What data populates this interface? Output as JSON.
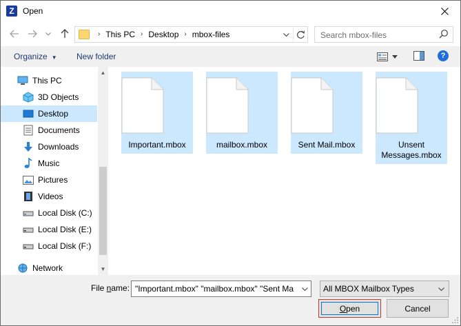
{
  "window": {
    "title": "Open",
    "app_icon_letter": "Z"
  },
  "address": {
    "crumbs": [
      "This PC",
      "Desktop",
      "mbox-files"
    ]
  },
  "search": {
    "placeholder": "Search mbox-files"
  },
  "toolbar": {
    "organize_label": "Organize",
    "new_folder_label": "New folder",
    "help_label": "?"
  },
  "nav": {
    "items": [
      {
        "label": "This PC",
        "icon": "this-pc-icon"
      },
      {
        "label": "3D Objects",
        "icon": "3d-objects-icon"
      },
      {
        "label": "Desktop",
        "icon": "desktop-icon",
        "selected": true
      },
      {
        "label": "Documents",
        "icon": "documents-icon"
      },
      {
        "label": "Downloads",
        "icon": "downloads-icon"
      },
      {
        "label": "Music",
        "icon": "music-icon"
      },
      {
        "label": "Pictures",
        "icon": "pictures-icon"
      },
      {
        "label": "Videos",
        "icon": "videos-icon"
      },
      {
        "label": "Local Disk (C:)",
        "icon": "drive-icon"
      },
      {
        "label": "Local Disk (E:)",
        "icon": "drive-icon"
      },
      {
        "label": "Local Disk (F:)",
        "icon": "drive-icon"
      },
      {
        "label": "Network",
        "icon": "network-icon"
      }
    ]
  },
  "files": [
    {
      "name": "Important.mbox",
      "selected": true
    },
    {
      "name": "mailbox.mbox",
      "selected": true
    },
    {
      "name": "Sent Mail.mbox",
      "selected": true
    },
    {
      "name": "Unsent Messages.mbox",
      "selected": true
    }
  ],
  "bottom": {
    "file_name_label_prefix": "File ",
    "file_name_label_underlined": "n",
    "file_name_label_suffix": "ame:",
    "file_name_value": "\"Important.mbox\" \"mailbox.mbox\" \"Sent Ma",
    "file_type_value": "All MBOX Mailbox Types",
    "open_label_underlined": "O",
    "open_label_rest": "pen",
    "cancel_label": "Cancel"
  },
  "colors": {
    "selection": "#cce8ff",
    "accent": "#0078d7",
    "toolbar_bg": "#f0f0f0"
  }
}
